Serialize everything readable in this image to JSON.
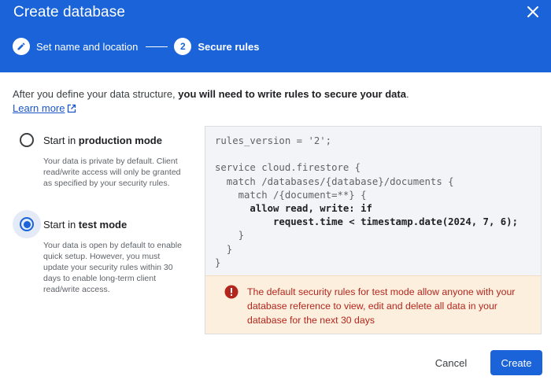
{
  "dialog": {
    "title": "Create database"
  },
  "stepper": {
    "steps": [
      {
        "label": "Set name and location",
        "icon": "pencil-icon",
        "state": "completed"
      },
      {
        "label": "Secure rules",
        "number": "2",
        "state": "active"
      }
    ]
  },
  "intro": {
    "text_before": "After you define your data structure, ",
    "text_bold": "you will need to write rules to secure your data",
    "text_after": ".",
    "learn_more": "Learn more"
  },
  "modes": [
    {
      "label_prefix": "Start in ",
      "label_bold": "production mode",
      "description": "Your data is private by default. Client read/write access will only be granted as specified by your security rules.",
      "selected": false
    },
    {
      "label_prefix": "Start in ",
      "label_bold": "test mode",
      "description": "Your data is open by default to enable quick setup. However, you must update your security rules within 30 days to enable long-term client read/write access.",
      "selected": true
    }
  ],
  "rules": {
    "lines": [
      "rules_version = '2';",
      "",
      "service cloud.firestore {",
      "  match /databases/{database}/documents {",
      "    match /{document=**} {",
      "      allow read, write: if",
      "          request.time < timestamp.date(2024, 7, 6);",
      "    }",
      "  }",
      "}"
    ],
    "warning": "The default security rules for test mode allow anyone with your database reference to view, edit and delete all data in your database for the next 30 days"
  },
  "footer": {
    "cancel_label": "Cancel",
    "create_label": "Create"
  },
  "colors": {
    "primary": "#1a63d8",
    "warning_text": "#b3261e",
    "warning_bg": "#fcefdd",
    "code_bg": "#f2f4f7"
  }
}
